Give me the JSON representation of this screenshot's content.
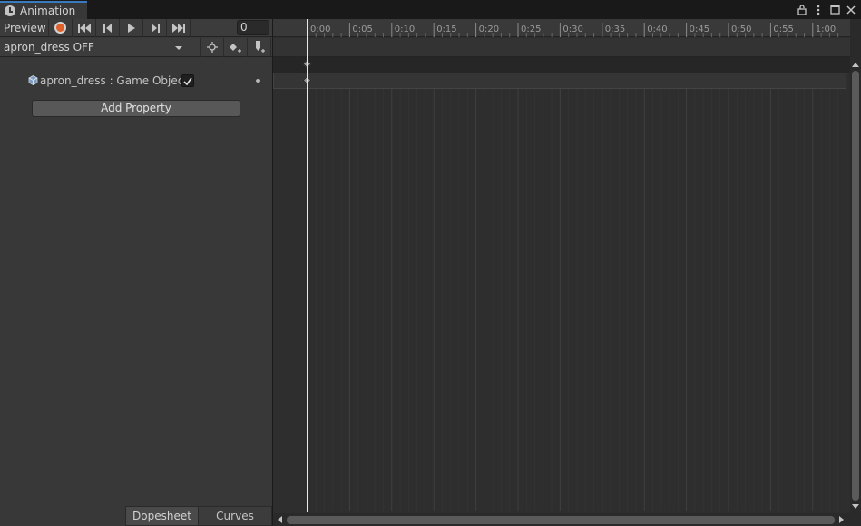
{
  "window": {
    "tab_title": "Animation",
    "tab_icon": "clock-icon",
    "controls": [
      "lock-icon",
      "kebab-menu-icon",
      "maximize-icon",
      "close-icon"
    ]
  },
  "toolbar": {
    "preview_label": "Preview",
    "record_color": "#e0602c",
    "buttons": [
      "record-button",
      "first-keyframe-button",
      "previous-keyframe-button",
      "play-button",
      "next-keyframe-button",
      "last-keyframe-button"
    ],
    "frame_value": "0"
  },
  "clip": {
    "selected": "apron_dress OFF",
    "tools": [
      "filter-by-selection-icon",
      "add-keyframe-icon",
      "add-event-icon"
    ]
  },
  "properties": [
    {
      "label": "apron_dress : Game Object.",
      "icon": "game-object-icon",
      "checked": true
    }
  ],
  "add_property_label": "Add Property",
  "view_tabs": {
    "dopesheet": "Dopesheet",
    "curves": "Curves",
    "active": "Dopesheet"
  },
  "timeline": {
    "ticks": [
      "0:00",
      "0:05",
      "0:10",
      "0:15",
      "0:20",
      "0:25",
      "0:30",
      "0:35",
      "0:40",
      "0:45",
      "0:50",
      "0:55",
      "1:00"
    ],
    "current_time": "0:00",
    "keyframes": [
      {
        "row": "summary",
        "time": "0:00"
      },
      {
        "row": "apron_dress : Game Object.",
        "time": "0:00"
      }
    ],
    "accent_color": "#3a79bb"
  }
}
